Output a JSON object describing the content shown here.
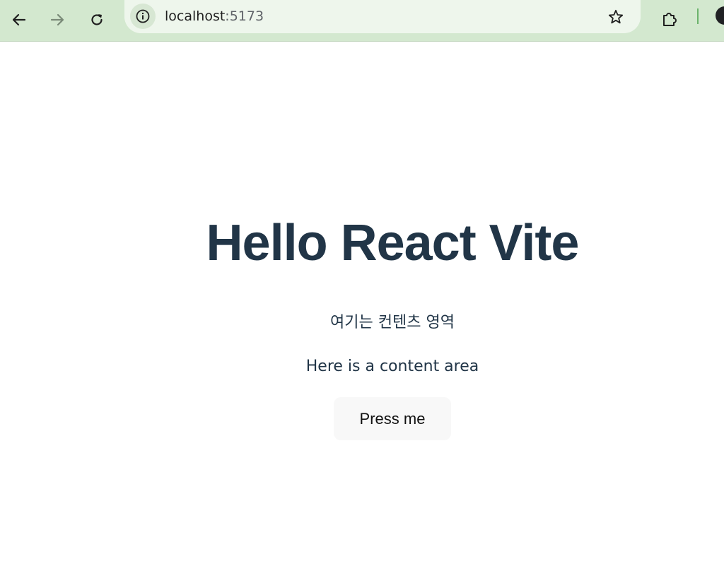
{
  "browser": {
    "url_host": "localhost",
    "url_port": ":5173",
    "icons": {
      "back": "back-arrow-icon",
      "forward": "forward-arrow-icon",
      "reload": "reload-icon",
      "site_info": "info-icon",
      "bookmark": "star-icon",
      "extensions": "puzzle-icon"
    },
    "colors": {
      "toolbar_bg": "#d3e8cf",
      "omnibox_bg": "#eef6ec"
    }
  },
  "page": {
    "heading": "Hello React Vite",
    "paragraph_korean": "여기는 컨텐츠 영역",
    "paragraph_english": "Here is a content area",
    "button_label": "Press me",
    "colors": {
      "text": "#213547",
      "button_bg": "#f8f8f8"
    }
  }
}
